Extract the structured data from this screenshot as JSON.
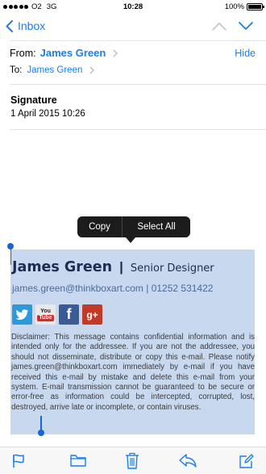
{
  "status_bar": {
    "carrier": "O2",
    "network": "3G",
    "time": "10:28",
    "battery": "100%",
    "battery_level": 1.0
  },
  "nav": {
    "back_label": "Inbox"
  },
  "header": {
    "from_label": "From:",
    "from_name": "James Green",
    "hide_label": "Hide",
    "to_label": "To:",
    "to_name": "James Green"
  },
  "message": {
    "subject": "Signature",
    "date": "1 April 2015 10:26"
  },
  "popup": {
    "copy_label": "Copy",
    "select_all_label": "Select All"
  },
  "signature": {
    "name": "James Green",
    "separator": "|",
    "title": "Senior Designer",
    "contact": "james.green@thinkboxart.com | 01252 531422",
    "social": [
      {
        "icon": "twitter-icon",
        "label": ""
      },
      {
        "icon": "youtube-icon",
        "label_top": "You",
        "label_bottom": "Tube"
      },
      {
        "icon": "facebook-icon",
        "label": "f"
      },
      {
        "icon": "google-plus-icon",
        "label": "g+"
      }
    ],
    "disclaimer": "Disclaimer: This message contains confidential information and is intended only for the addressee. If you are not the addressee, you should not disseminate, distribute or copy this e-mail. Please notify james.green@thinkboxart.com immediately by e-mail if you have received this e-mail by mistake and delete this e-mail from your system. E-mail transmission cannot be guaranteed to be secure or error-free as information could be intercepted, corrupted, lost, destroyed, arrive late or incomplete, or contain viruses."
  },
  "toolbar": {
    "icons": [
      "flag-icon",
      "folder-icon",
      "trash-icon",
      "reply-icon",
      "compose-icon"
    ]
  },
  "colors": {
    "accent": "#1a7df0",
    "selection": "#c8d9ef",
    "signature_name": "#1b2d52",
    "signature_contact": "#4a6a9c"
  }
}
